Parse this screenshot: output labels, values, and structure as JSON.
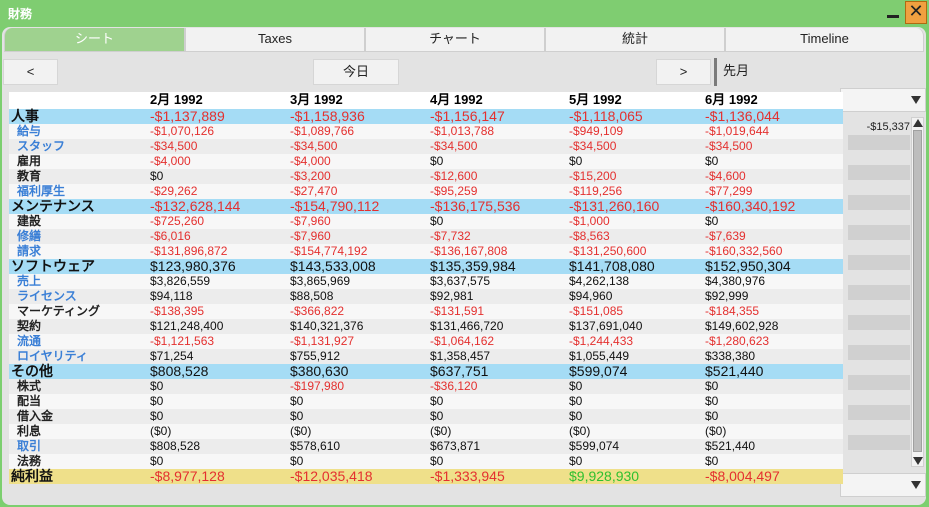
{
  "window": {
    "title": "財務"
  },
  "tabs": [
    {
      "label": "シート"
    },
    {
      "label": "Taxes"
    },
    {
      "label": "チャート"
    },
    {
      "label": "統計"
    },
    {
      "label": "Timeline"
    }
  ],
  "nav": {
    "prev": "<",
    "today": "今日",
    "next": ">",
    "period": "先月"
  },
  "side_value": "-$15,337",
  "columns": [
    "2月 1992",
    "3月 1992",
    "4月 1992",
    "5月 1992",
    "6月 1992"
  ],
  "rows": [
    {
      "label": "人事",
      "kind": "sec",
      "values": [
        "-$1,137,889",
        "-$1,158,936",
        "-$1,156,147",
        "-$1,118,065",
        "-$1,136,044"
      ]
    },
    {
      "label": "給与",
      "kind": "link",
      "values": [
        "-$1,070,126",
        "-$1,089,766",
        "-$1,013,788",
        "-$949,109",
        "-$1,019,644"
      ]
    },
    {
      "label": "スタッフ",
      "kind": "link",
      "values": [
        "-$34,500",
        "-$34,500",
        "-$34,500",
        "-$34,500",
        "-$34,500"
      ]
    },
    {
      "label": "雇用",
      "kind": "sub",
      "values": [
        "-$4,000",
        "-$4,000",
        "$0",
        "$0",
        "$0"
      ]
    },
    {
      "label": "教育",
      "kind": "sub",
      "values": [
        "$0",
        "-$3,200",
        "-$12,600",
        "-$15,200",
        "-$4,600"
      ]
    },
    {
      "label": "福利厚生",
      "kind": "link",
      "values": [
        "-$29,262",
        "-$27,470",
        "-$95,259",
        "-$119,256",
        "-$77,299"
      ]
    },
    {
      "label": "メンテナンス",
      "kind": "sec",
      "values": [
        "-$132,628,144",
        "-$154,790,112",
        "-$136,175,536",
        "-$131,260,160",
        "-$160,340,192"
      ]
    },
    {
      "label": "建設",
      "kind": "sub",
      "values": [
        "-$725,260",
        "-$7,960",
        "$0",
        "-$1,000",
        "$0"
      ]
    },
    {
      "label": "修繕",
      "kind": "link",
      "values": [
        "-$6,016",
        "-$7,960",
        "-$7,732",
        "-$8,563",
        "-$7,639"
      ]
    },
    {
      "label": "請求",
      "kind": "link",
      "values": [
        "-$131,896,872",
        "-$154,774,192",
        "-$136,167,808",
        "-$131,250,600",
        "-$160,332,560"
      ]
    },
    {
      "label": "ソフトウェア",
      "kind": "sec",
      "values": [
        "$123,980,376",
        "$143,533,008",
        "$135,359,984",
        "$141,708,080",
        "$152,950,304"
      ]
    },
    {
      "label": "売上",
      "kind": "link",
      "values": [
        "$3,826,559",
        "$3,865,969",
        "$3,637,575",
        "$4,262,138",
        "$4,380,976"
      ]
    },
    {
      "label": "ライセンス",
      "kind": "link",
      "values": [
        "$94,118",
        "$88,508",
        "$92,981",
        "$94,960",
        "$92,999"
      ]
    },
    {
      "label": "マーケティング",
      "kind": "sub",
      "values": [
        "-$138,395",
        "-$366,822",
        "-$131,591",
        "-$151,085",
        "-$184,355"
      ]
    },
    {
      "label": "契約",
      "kind": "sub",
      "values": [
        "$121,248,400",
        "$140,321,376",
        "$131,466,720",
        "$137,691,040",
        "$149,602,928"
      ]
    },
    {
      "label": "流通",
      "kind": "link",
      "values": [
        "-$1,121,563",
        "-$1,131,927",
        "-$1,064,162",
        "-$1,244,433",
        "-$1,280,623"
      ]
    },
    {
      "label": "ロイヤリティ",
      "kind": "link",
      "values": [
        "$71,254",
        "$755,912",
        "$1,358,457",
        "$1,055,449",
        "$338,380"
      ]
    },
    {
      "label": "その他",
      "kind": "sec",
      "values": [
        "$808,528",
        "$380,630",
        "$637,751",
        "$599,074",
        "$521,440"
      ]
    },
    {
      "label": "株式",
      "kind": "sub",
      "values": [
        "$0",
        "-$197,980",
        "-$36,120",
        "$0",
        "$0"
      ]
    },
    {
      "label": "配当",
      "kind": "sub",
      "values": [
        "$0",
        "$0",
        "$0",
        "$0",
        "$0"
      ]
    },
    {
      "label": "借入金",
      "kind": "sub",
      "values": [
        "$0",
        "$0",
        "$0",
        "$0",
        "$0"
      ]
    },
    {
      "label": "利息",
      "kind": "sub",
      "values": [
        "($0)",
        "($0)",
        "($0)",
        "($0)",
        "($0)"
      ]
    },
    {
      "label": "取引",
      "kind": "link",
      "values": [
        "$808,528",
        "$578,610",
        "$673,871",
        "$599,074",
        "$521,440"
      ]
    },
    {
      "label": "法務",
      "kind": "sub",
      "values": [
        "$0",
        "$0",
        "$0",
        "$0",
        "$0"
      ]
    },
    {
      "label": "純利益",
      "kind": "total",
      "values": [
        "-$8,977,128",
        "-$12,035,418",
        "-$1,333,945",
        "$9,928,930",
        "-$8,004,497"
      ]
    }
  ],
  "colors": {
    "negative": "#e4302f",
    "positive": "#111111",
    "net_positive": "#2fc02f",
    "section_bg": "#a5dcf5",
    "total_bg": "#efe08a",
    "link": "#3a7fd6"
  }
}
